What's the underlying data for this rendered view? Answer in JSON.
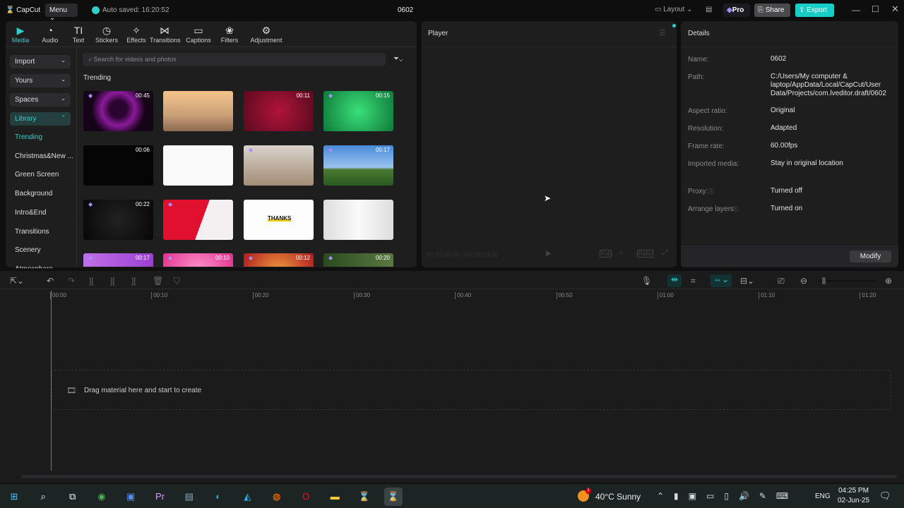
{
  "app": {
    "logo": "CapCut",
    "menu": "Menu",
    "autosave": "Auto saved: 16:20:52",
    "project": "0602",
    "layout": "Layout",
    "pro": "Pro",
    "share": "Share",
    "export": "Export"
  },
  "tabs": [
    {
      "label": "Media",
      "icon": "▶"
    },
    {
      "label": "Audio",
      "icon": "◔"
    },
    {
      "label": "Text",
      "icon": "TI"
    },
    {
      "label": "Stickers",
      "icon": "◷"
    },
    {
      "label": "Effects",
      "icon": "✧"
    },
    {
      "label": "Transitions",
      "icon": "⋈"
    },
    {
      "label": "Captions",
      "icon": "▭"
    },
    {
      "label": "Filters",
      "icon": "❀"
    },
    {
      "label": "Adjustment",
      "icon": "⚙"
    }
  ],
  "sidebar": {
    "buttons": [
      "Import",
      "Yours",
      "Spaces",
      "Library"
    ],
    "items": [
      "Trending",
      "Christmas&New ...",
      "Green Screen",
      "Background",
      "Intro&End",
      "Transitions",
      "Scenery",
      "Atmosphere"
    ]
  },
  "search": {
    "placeholder": "Search for videos and photos"
  },
  "section": "Trending",
  "thumbs": [
    {
      "dur": "00:45",
      "pro": true,
      "bg": "radial-gradient(circle at 50% 45%,#2a0530 20%,#8a1a9a 40%,#150318 65%)"
    },
    {
      "dur": "",
      "pro": false,
      "bg": "linear-gradient(180deg,#f5c48a,#caa078 60%,#8c6a50)"
    },
    {
      "dur": "00:11",
      "pro": false,
      "bg": "radial-gradient(circle,#b0143a,#5a0a1e)"
    },
    {
      "dur": "00:15",
      "pro": true,
      "bg": "radial-gradient(circle,#3adf78,#0f7a3a)"
    },
    {
      "dur": "00:06",
      "pro": false,
      "bg": "#050505"
    },
    {
      "dur": "",
      "pro": false,
      "bg": "#fafafa"
    },
    {
      "dur": "",
      "pro": true,
      "bg": "linear-gradient(180deg,#d8d4cc,#b8a898 60%,#a48e78)"
    },
    {
      "dur": "00:17",
      "pro": true,
      "bg": "linear-gradient(180deg,#4a8ad8,#9ac4ee 55%,#4a7a30 60%,#2a5a20)"
    },
    {
      "dur": "00:22",
      "pro": true,
      "bg": "radial-gradient(circle,#222,#070707)"
    },
    {
      "dur": "",
      "pro": true,
      "bg": "linear-gradient(110deg,#e0102e 55%,#f4f0f2 55%)"
    },
    {
      "dur": "",
      "pro": false,
      "bg": "#fdfdfd",
      "text": "THANKS"
    },
    {
      "dur": "",
      "pro": false,
      "bg": "linear-gradient(90deg,#ddd,#fafafa 50%,#ddd)"
    },
    {
      "dur": "00:17",
      "pro": true,
      "bg": "linear-gradient(90deg,#c070e8,#9a40d0)"
    },
    {
      "dur": "00:10",
      "pro": true,
      "bg": "radial-gradient(circle,#ff9ad0,#e0308a)"
    },
    {
      "dur": "00:12",
      "pro": true,
      "bg": "radial-gradient(circle,#f0a040,#b01820)"
    },
    {
      "dur": "00:20",
      "pro": true,
      "bg": "linear-gradient(90deg,#2a4a20,#5a7a40)"
    }
  ],
  "player": {
    "title": "Player",
    "time": "00:00:00:00 / 00:00:00:00",
    "full": "Full",
    "ratio": "Ratio"
  },
  "details": {
    "title": "Details",
    "rows": [
      {
        "label": "Name:",
        "value": "0602"
      },
      {
        "label": "Path:",
        "value": "C:/Users/My computer & laptop/AppData/Local/CapCut/User Data/Projects/com.lveditor.draft/0602"
      },
      {
        "label": "Aspect ratio:",
        "value": "Original"
      },
      {
        "label": "Resolution:",
        "value": "Adapted"
      },
      {
        "label": "Frame rate:",
        "value": "60.00fps"
      },
      {
        "label": "Imported media:",
        "value": "Stay in original location"
      },
      {
        "label": "Proxy:",
        "value": "Turned off"
      },
      {
        "label": "Arrange layers",
        "value": "Turned on"
      }
    ],
    "modify": "Modify"
  },
  "timeline": {
    "ticks": [
      "00:00",
      "00:10",
      "00:20",
      "00:30",
      "00:40",
      "00:50",
      "01:00",
      "01:10",
      "01:20"
    ],
    "drop": "Drag material here and start to create",
    "zoom": 0.05
  },
  "taskbar": {
    "weather": "40°C  Sunny",
    "lang": "ENG",
    "time": "04:25 PM",
    "date": "02-Jun-25",
    "badge": "1"
  }
}
